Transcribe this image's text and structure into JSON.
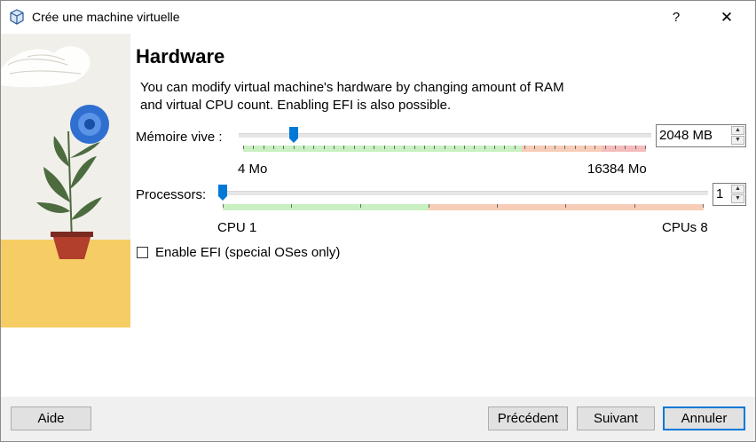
{
  "window": {
    "title": "Crée une machine virtuelle",
    "help_label": "?",
    "close_label": "✕"
  },
  "page": {
    "heading": "Hardware",
    "description_line1": "You can modify virtual machine's hardware by changing amount of RAM",
    "description_line2": "and virtual CPU count. Enabling EFI is also possible."
  },
  "memory": {
    "label": "Mémoire vive :",
    "value": "2048 MB",
    "min_label": "4 Mo",
    "max_label": "16384 Mo",
    "min_mb": 4,
    "max_mb": 16384,
    "current_mb": 2048
  },
  "processors": {
    "label": "Processors:",
    "value": "1",
    "min_label": "CPU 1",
    "max_label": "CPUs 8",
    "min": 1,
    "max": 8,
    "current": 1
  },
  "efi": {
    "label": "Enable EFI (special OSes only)",
    "checked": false
  },
  "buttons": {
    "help": "Aide",
    "previous": "Précédent",
    "next": "Suivant",
    "cancel": "Annuler"
  },
  "colors": {
    "safe_zone": "#c8f0c0",
    "warn_zone": "#f8cdb8",
    "danger_zone": "#f5bcbc",
    "handle": "#0078d7",
    "default_button_border": "#0078d7"
  },
  "icons": {
    "app": "virtualbox-cube-icon",
    "help": "question-mark-icon",
    "close": "close-icon",
    "spin_up": "arrow-up-icon",
    "spin_down": "arrow-down-icon"
  }
}
